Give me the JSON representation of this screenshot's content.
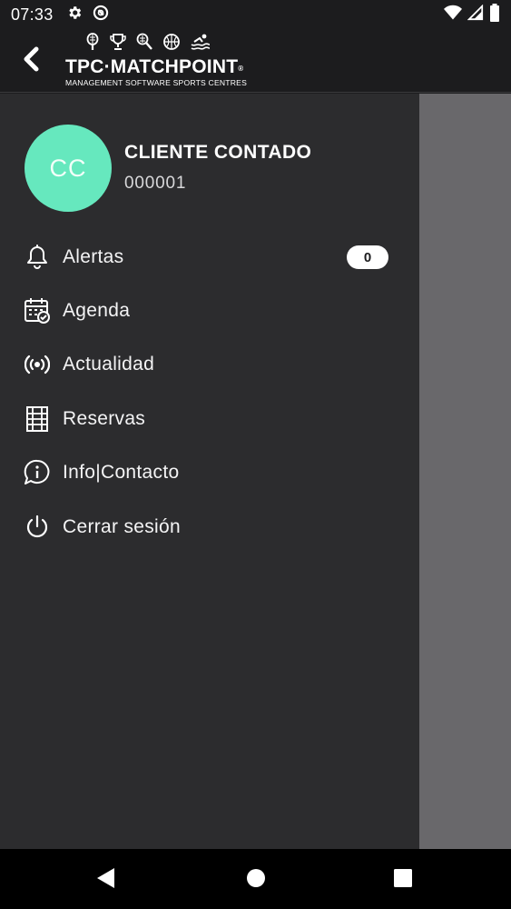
{
  "status_bar": {
    "time": "07:33",
    "icons": [
      "gear-icon",
      "sync-icon",
      "wifi-icon",
      "signal-icon",
      "battery-icon"
    ]
  },
  "header": {
    "back_icon": "chevron-left-icon",
    "logo_title": "TPC·MATCHPOINT",
    "logo_registered": "®",
    "logo_subtitle": "MANAGEMENT SOFTWARE SPORTS CENTRES",
    "logo_sport_icons": [
      "tennis-racket-icon",
      "trophy-icon",
      "badminton-icon",
      "basketball-icon",
      "swimming-icon"
    ]
  },
  "profile": {
    "initials": "CC",
    "name": "CLIENTE CONTADO",
    "id": "000001",
    "avatar_color": "#66e8be"
  },
  "menu": {
    "items": [
      {
        "label": "Alertas",
        "icon": "bell-icon",
        "badge": "0"
      },
      {
        "label": "Agenda",
        "icon": "calendar-check-icon"
      },
      {
        "label": "Actualidad",
        "icon": "broadcast-icon"
      },
      {
        "label": "Reservas",
        "icon": "court-grid-icon"
      },
      {
        "label": "Info|Contacto",
        "icon": "info-chat-icon"
      },
      {
        "label": "Cerrar sesión",
        "icon": "power-icon"
      }
    ]
  },
  "nav_bar": {
    "icons": [
      "back-triangle-icon",
      "home-circle-icon",
      "recents-square-icon"
    ]
  }
}
